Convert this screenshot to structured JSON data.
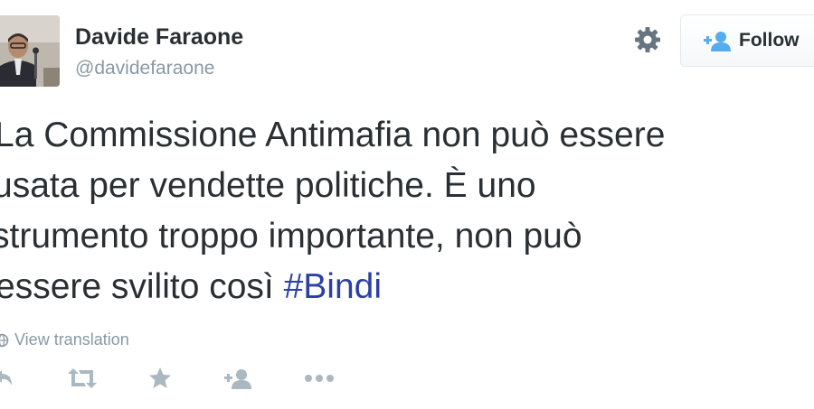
{
  "author": {
    "display_name": "Davide Faraone",
    "handle": "@davidefaraone",
    "avatar": "profile-photo"
  },
  "header": {
    "settings_icon": "gear-icon",
    "follow_label": "Follow",
    "follow_icon": "add-user-icon"
  },
  "tweet": {
    "lines": [
      "La Commissione Antimafia non può essere",
      "usata per vendette politiche. È uno",
      "strumento troppo importante, non può",
      "essere svilito così "
    ],
    "hashtag": "#Bindi"
  },
  "translation": {
    "label": "View translation",
    "icon": "globe-icon"
  },
  "actions": [
    {
      "name": "reply",
      "icon": "reply-icon"
    },
    {
      "name": "retweet",
      "icon": "retweet-icon"
    },
    {
      "name": "favorite",
      "icon": "star-icon"
    },
    {
      "name": "follow",
      "icon": "add-user-icon"
    },
    {
      "name": "more",
      "icon": "more-icon"
    }
  ],
  "colors": {
    "text": "#292f33",
    "muted": "#8899a6",
    "hashtag": "#2b3fa8",
    "icon": "#aab8c2"
  }
}
